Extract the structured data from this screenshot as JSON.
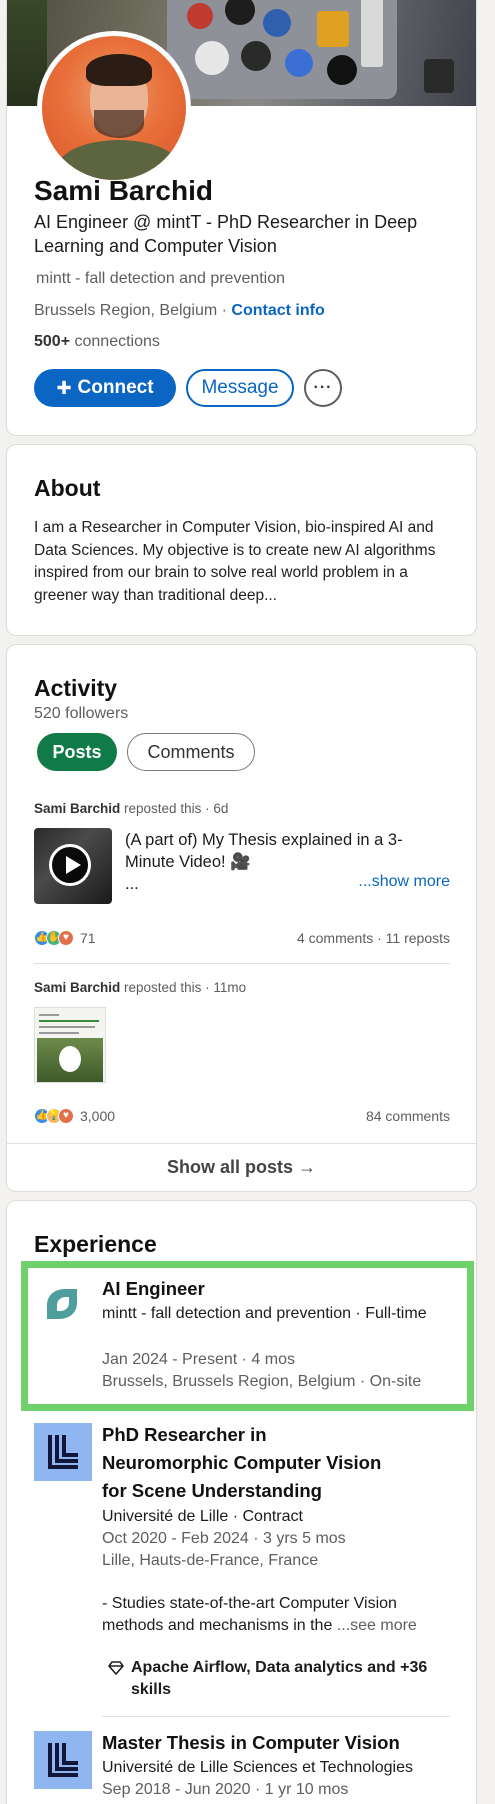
{
  "profile": {
    "name": "Sami Barchid",
    "headline": "AI Engineer @ mintT - PhD Researcher in Deep Learning and Computer Vision",
    "company": "mintt - fall detection and prevention",
    "location": "Brussels Region, Belgium",
    "location_sep": " · ",
    "contact_info": "Contact info",
    "connections_count": "500+",
    "connections_label": " connections",
    "buttons": {
      "connect": "Connect",
      "message": "Message",
      "more": "···"
    }
  },
  "about": {
    "title": "About",
    "text": "I am a Researcher in Computer Vision, bio-inspired AI and Data Sciences. My objective is to create new AI algorithms inspired from our brain to solve real world problem in a greener way than traditional deep..."
  },
  "activity": {
    "title": "Activity",
    "followers": "520 followers",
    "tabs": {
      "posts": "Posts",
      "comments": "Comments"
    },
    "posts": [
      {
        "author": "Sami Barchid",
        "action": " reposted this · 6d",
        "text": "(A part of) My Thesis explained in a 3-Minute Video! 🎥",
        "ellipsis": "...",
        "show_more": "...show more",
        "reactions": "71",
        "stats": "4 comments · 11 reposts"
      },
      {
        "author": "Sami Barchid",
        "action": " reposted this · 11mo",
        "reactions": "3,000",
        "stats": "84 comments"
      }
    ],
    "show_all": "Show all posts →"
  },
  "experience": {
    "title": "Experience",
    "items": [
      {
        "title": "AI Engineer",
        "company": "mintt - fall detection and prevention · Full-time",
        "dates": "Jan 2024 - Present · 4 mos",
        "location": "Brussels, Brussels Region, Belgium · On-site"
      },
      {
        "title": "PhD Researcher in Neuromorphic Computer Vision for Scene Understanding",
        "company": "Université de Lille · Contract",
        "dates": "Oct 2020 - Feb 2024 · 3 yrs 5 mos",
        "location": "Lille, Hauts-de-France, France",
        "description": "- Studies state-of-the-art Computer Vision methods and mechanisms in the",
        "see_more": "...see more",
        "skills": "Apache Airflow, Data analytics and +36 skills"
      },
      {
        "title": "Master Thesis in Computer Vision",
        "company": "Université de Lille Sciences et Technologies",
        "dates": "Sep 2018 - Jun 2020 · 1 yr 10 mos"
      }
    ]
  },
  "colors": {
    "accent": "#0a66c2",
    "posts_pill": "#117a49",
    "highlight": "#6fd16b"
  }
}
